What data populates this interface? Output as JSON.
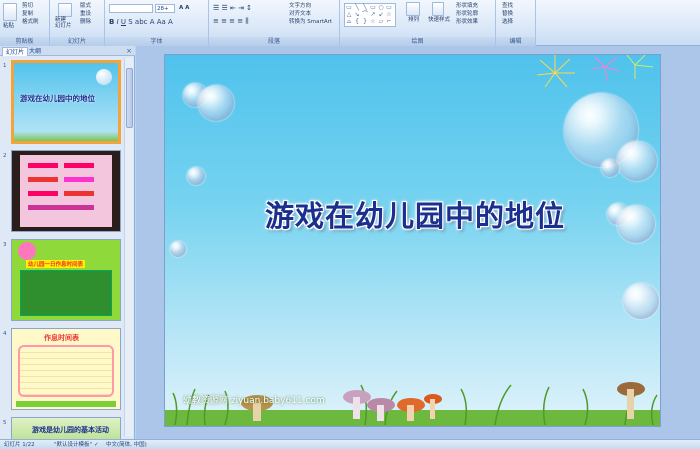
{
  "ribbon": {
    "clipboard": {
      "label": "剪贴板",
      "paste": "粘贴",
      "cut": "剪切",
      "copy": "复制",
      "format_painter": "格式刷"
    },
    "slides": {
      "label": "幻灯片",
      "new_slide": "新建\n幻灯片",
      "layout": "版式",
      "reset": "重设",
      "delete": "删除"
    },
    "font": {
      "label": "字体",
      "size": "28+"
    },
    "paragraph": {
      "label": "段落",
      "text_direction": "文字方向",
      "align_text": "对齐文本",
      "smartart": "转换为 SmartArt"
    },
    "drawing": {
      "label": "绘图",
      "arrange": "排列",
      "quick_styles": "快速样式",
      "shape_fill": "形状填充",
      "shape_outline": "形状轮廓",
      "shape_effects": "形状效果"
    },
    "editing": {
      "label": "编辑",
      "find": "查找",
      "replace": "替换",
      "select": "选择"
    }
  },
  "panel": {
    "tab_slides": "幻灯片",
    "tab_outline": "大纲",
    "close": "×",
    "thumbs": [
      {
        "num": "1",
        "title": "游戏在幼儿园中的地位"
      },
      {
        "num": "2"
      },
      {
        "num": "3",
        "title": "幼儿园一日作息时间表"
      },
      {
        "num": "4",
        "title": "作息时间表"
      },
      {
        "num": "5",
        "title": "游戏是幼儿园的基本活动"
      }
    ]
  },
  "slide": {
    "title": "游戏在幼儿园中的地位",
    "watermark": "幼教资源网 ziyuan.baby611.com"
  },
  "status": {
    "slide_indicator": "幻灯片 1/22",
    "theme": "\"默认设计模板\"",
    "language": "中文(简体, 中国)"
  },
  "colors": {
    "accent": "#f2a33a",
    "title": "#1b2f8f",
    "sky": "#4fc2ec"
  }
}
